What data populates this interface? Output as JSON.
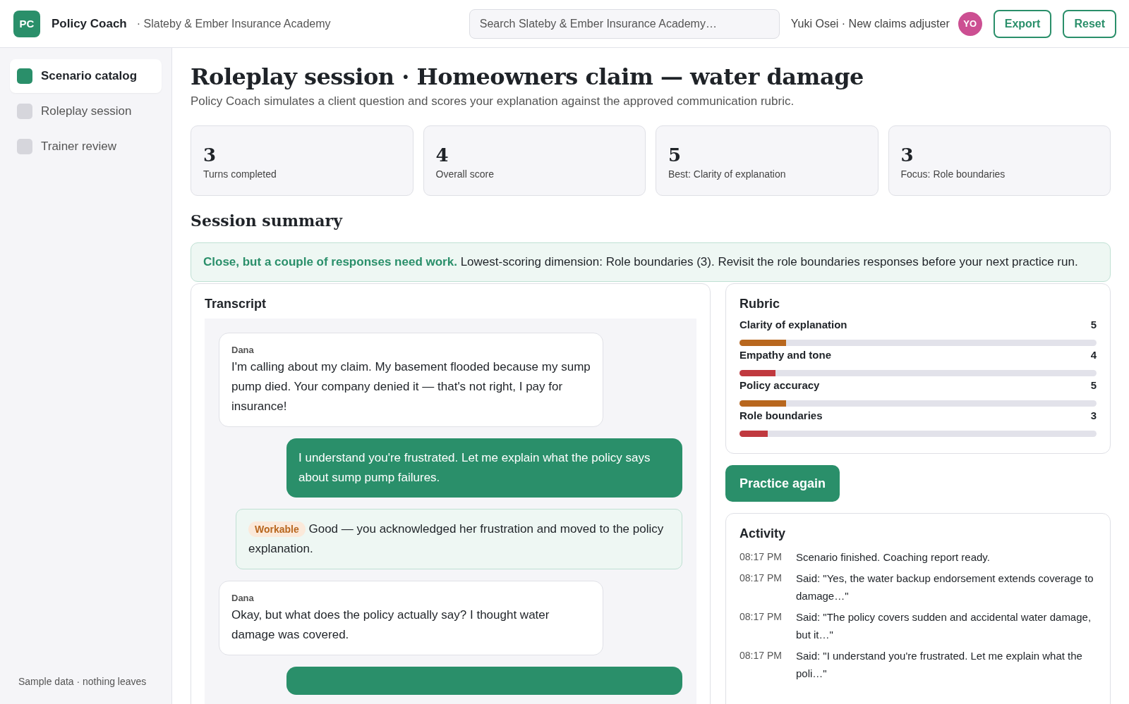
{
  "app": {
    "logo": "PC",
    "name": "Policy Coach",
    "org": "· Slateby & Ember Insurance Academy"
  },
  "search": {
    "placeholder": "Search Slateby & Ember Insurance Academy…"
  },
  "user": {
    "label": "Yuki Osei · New claims adjuster",
    "initials": "YO"
  },
  "header_buttons": [
    "Export",
    "Reset"
  ],
  "sidebar": {
    "items": [
      {
        "label": "Scenario catalog",
        "selected": true
      },
      {
        "label": "Roleplay session",
        "selected": false
      },
      {
        "label": "Trainer review",
        "selected": false
      }
    ],
    "footer": "Sample data · nothing leaves"
  },
  "page": {
    "title": "Roleplay session · Homeowners claim — water damage",
    "subtitle": "Policy Coach simulates a client question and scores your explanation against the approved communication rubric."
  },
  "stats": [
    {
      "value": "3",
      "label": "Turns completed"
    },
    {
      "value": "4",
      "label": "Overall score"
    },
    {
      "value": "5",
      "label": "Best: Clarity of explanation"
    },
    {
      "value": "3",
      "label": "Focus: Role boundaries"
    }
  ],
  "summary": {
    "heading": "Session summary",
    "text": "**Close, but a couple of responses need work.** Lowest-scoring dimension: Role boundaries (3). Revisit the role boundaries responses before your next practice run."
  },
  "transcript": {
    "heading": "Transcript",
    "messages": [
      {
        "kind": "client",
        "speaker": "Dana",
        "text": "I'm calling about my claim. My basement flooded because my sump pump died. Your company denied it — that's not right, I pay for insurance!"
      },
      {
        "kind": "agent",
        "text": "I understand you're frustrated. Let me explain what the policy says about sump pump failures."
      },
      {
        "kind": "feedback",
        "tag": "Workable",
        "text": "Good — you acknowledged her frustration and moved to the policy explanation."
      },
      {
        "kind": "client",
        "speaker": "Dana",
        "text": "Okay, but what does the policy actually say? I thought water damage was covered."
      },
      {
        "kind": "agent_clipped"
      }
    ]
  },
  "rubric": {
    "heading": "Rubric",
    "items": [
      {
        "name": "Clarity of explanation",
        "score": "5",
        "level": 0.13,
        "color": "#b8671e"
      },
      {
        "name": "Empathy and tone",
        "score": "4",
        "level": 0.1,
        "color": "#c0393f"
      },
      {
        "name": "Policy accuracy",
        "score": "5",
        "level": 0.13,
        "color": "#b8671e"
      },
      {
        "name": "Role boundaries",
        "score": "3",
        "level": 0.08,
        "color": "#c0393f"
      }
    ]
  },
  "practice_button": "Practice again",
  "activity": {
    "heading": "Activity",
    "entries": [
      {
        "time": "08:17 PM",
        "text": "Scenario finished. Coaching report ready."
      },
      {
        "time": "08:17 PM",
        "text": "Said: \"Yes, the water backup endorsement extends coverage to damage…\""
      },
      {
        "time": "08:17 PM",
        "text": "Said: \"The policy covers sudden and accidental water damage, but it…\""
      },
      {
        "time": "08:17 PM",
        "text": "Said: \"I understand you're frustrated. Let me explain what the poli…\""
      }
    ]
  }
}
